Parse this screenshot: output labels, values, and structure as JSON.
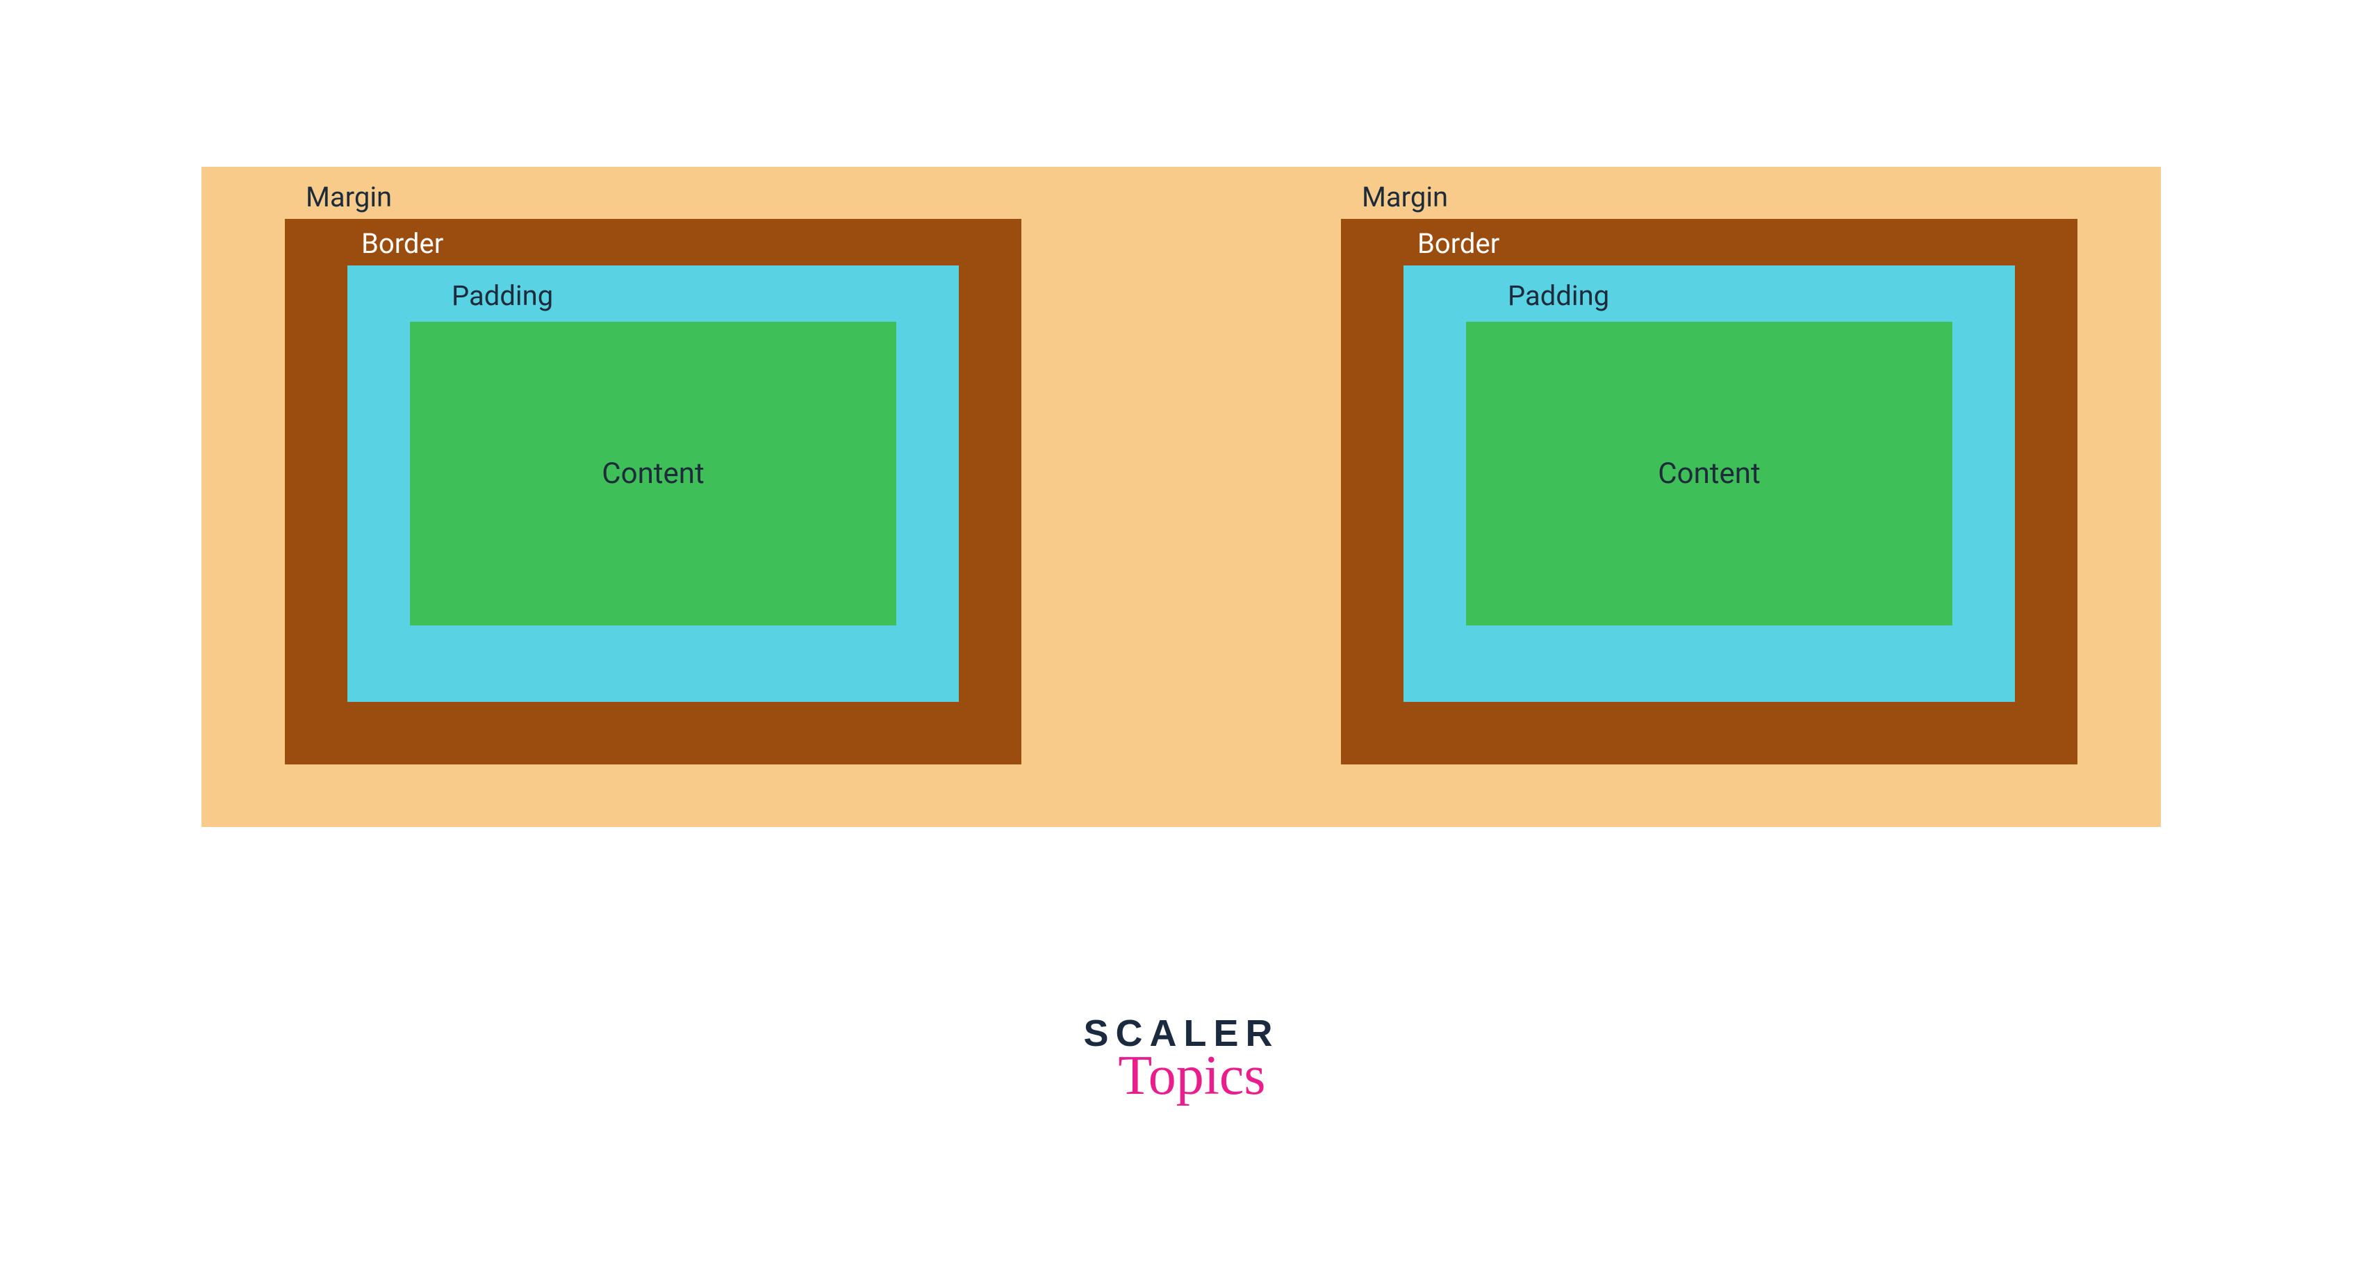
{
  "boxes": [
    {
      "margin_label": "Margin",
      "border_label": "Border",
      "padding_label": "Padding",
      "content_label": "Content"
    },
    {
      "margin_label": "Margin",
      "border_label": "Border",
      "padding_label": "Padding",
      "content_label": "Content"
    }
  ],
  "colors": {
    "margin": "#f8cb8a",
    "border": "#9b4d0f",
    "padding": "#59d3e4",
    "content": "#3fbf57"
  },
  "logo": {
    "line1": "SCALER",
    "line2": "Topics"
  }
}
